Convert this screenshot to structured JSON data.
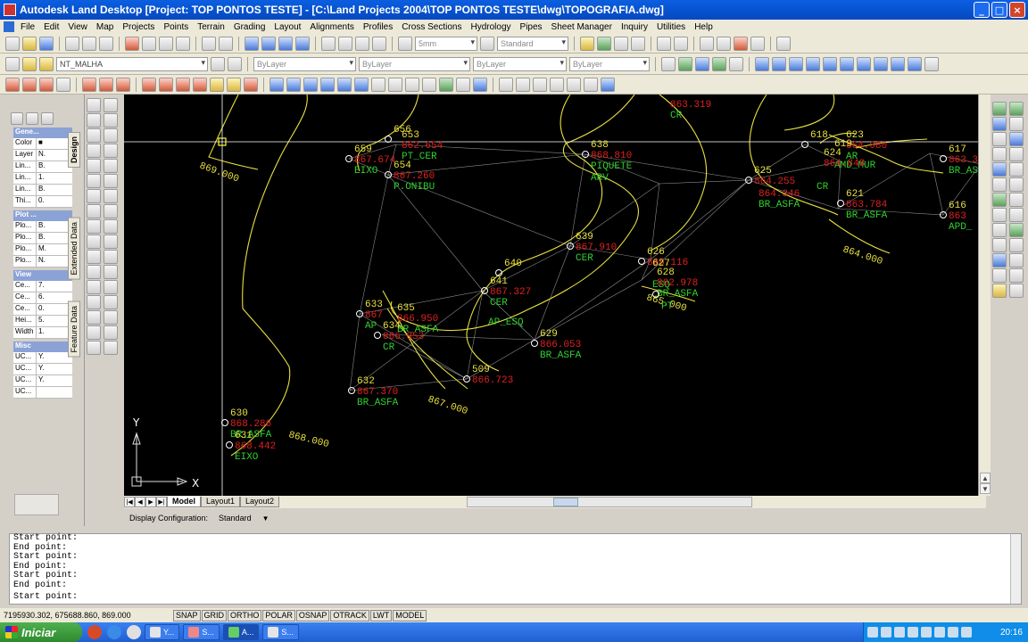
{
  "window": {
    "title": "Autodesk Land Desktop [Project: TOP PONTOS TESTE] - [C:\\Land Projects 2004\\TOP PONTOS TESTE\\dwg\\TOPOGRAFIA.dwg]"
  },
  "menu": [
    "File",
    "Edit",
    "View",
    "Map",
    "Projects",
    "Points",
    "Terrain",
    "Grading",
    "Layout",
    "Alignments",
    "Profiles",
    "Cross Sections",
    "Hydrology",
    "Pipes",
    "Sheet Manager",
    "Inquiry",
    "Utilities",
    "Help"
  ],
  "toolbar": {
    "text_height": "5mm",
    "text_style": "Standard",
    "layer": "NT_MALHA",
    "color": "ByLayer",
    "linetype": "ByLayer",
    "lineweight": "ByLayer",
    "plotstyle": "ByLayer"
  },
  "properties": {
    "tabs": [
      "Design",
      "Extended Data",
      "Feature Data"
    ],
    "sections": [
      {
        "title": "Gene...",
        "rows": [
          [
            "Color",
            "■"
          ],
          [
            "Layer",
            "N."
          ],
          [
            "Lin...",
            "B."
          ],
          [
            "Lin...",
            "1."
          ],
          [
            "Lin...",
            "B."
          ],
          [
            "Thi...",
            "0."
          ]
        ]
      },
      {
        "title": "Plot ...",
        "rows": [
          [
            "Plo...",
            "B."
          ],
          [
            "Plo...",
            "B."
          ],
          [
            "Plo...",
            "M."
          ],
          [
            "Plo...",
            "N."
          ]
        ]
      },
      {
        "title": "View",
        "rows": [
          [
            "Ce...",
            "7."
          ],
          [
            "Ce...",
            "6."
          ],
          [
            "Ce...",
            "0."
          ],
          [
            "Hei...",
            "5."
          ],
          [
            "Width",
            "1."
          ]
        ]
      },
      {
        "title": "Misc",
        "rows": [
          [
            "UC...",
            "Y."
          ],
          [
            "UC...",
            "Y."
          ],
          [
            "UC...",
            "Y."
          ],
          [
            "UC...",
            ""
          ]
        ]
      }
    ]
  },
  "drawing": {
    "contours": [
      {
        "label": "869.000"
      },
      {
        "label": "864.000"
      },
      {
        "label": "867.000"
      },
      {
        "label": "868.000"
      },
      {
        "label": "865.000"
      }
    ],
    "points": [
      {
        "num": "659",
        "elev": "867.674",
        "desc": "EIXO"
      },
      {
        "num": "656",
        "elev": "",
        "desc": ""
      },
      {
        "num": "653",
        "elev": "862.654",
        "desc": "PT_CER"
      },
      {
        "num": "654",
        "elev": "867.260",
        "desc": "P.ONIBU"
      },
      {
        "num": "638",
        "elev": "868.810",
        "desc": "PIQUETE"
      },
      {
        "num": "",
        "elev": "",
        "desc": "ARV"
      },
      {
        "num": "",
        "elev": "863.319",
        "desc": "CR"
      },
      {
        "num": "618",
        "elev": "",
        "desc": ""
      },
      {
        "num": "623",
        "elev": "864.080",
        "desc": "AR"
      },
      {
        "num": "619",
        "elev": "",
        "desc": "AMD_MUR"
      },
      {
        "num": "624",
        "elev": "864.848",
        "desc": ""
      },
      {
        "num": "",
        "elev": "",
        "desc": "CR"
      },
      {
        "num": "617",
        "elev": "863.397",
        "desc": "BR_ASF"
      },
      {
        "num": "625",
        "elev": "864.255",
        "desc": ""
      },
      {
        "num": "",
        "elev": "864.346",
        "desc": "BR_ASFA"
      },
      {
        "num": "621",
        "elev": "863.784",
        "desc": "BR_ASFA"
      },
      {
        "num": "616",
        "elev": "863",
        "desc": "APD_"
      },
      {
        "num": "639",
        "elev": "867.910",
        "desc": "CER"
      },
      {
        "num": "626",
        "elev": "865.116",
        "desc": ""
      },
      {
        "num": "627",
        "elev": "",
        "desc": "ESQ"
      },
      {
        "num": "628",
        "elev": "862.978",
        "desc": "BR_ASFA"
      },
      {
        "num": "",
        "elev": "",
        "desc": "PT"
      },
      {
        "num": "640",
        "elev": "",
        "desc": ""
      },
      {
        "num": "641",
        "elev": "867.327",
        "desc": "CER"
      },
      {
        "num": "",
        "elev": "",
        "desc": "AP_ESQ"
      },
      {
        "num": "633",
        "elev": "867",
        "desc": "AP"
      },
      {
        "num": "635",
        "elev": "866.950",
        "desc": "BR_ASFA"
      },
      {
        "num": "634",
        "elev": "866.953",
        "desc": "CR"
      },
      {
        "num": "629",
        "elev": "866.053",
        "desc": "BR_ASFA"
      },
      {
        "num": "509",
        "elev": "866.723",
        "desc": ""
      },
      {
        "num": "632",
        "elev": "867.370",
        "desc": "BR_ASFA"
      },
      {
        "num": "630",
        "elev": "868.286",
        "desc": "BR_ASFA"
      },
      {
        "num": "631",
        "elev": "868.442",
        "desc": "EIXO"
      }
    ],
    "ucs_x": "X",
    "ucs_y": "Y"
  },
  "layout_tabs": [
    "Model",
    "Layout1",
    "Layout2"
  ],
  "display_config": {
    "label": "Display Configuration:",
    "value": "Standard"
  },
  "command_lines": [
    "Start point:",
    "End point:",
    "Start point:",
    "End point:",
    "Start point:",
    "End point:"
  ],
  "command_prompt": "Start point:",
  "status": {
    "coords": "7195930.302, 675688.860, 869.000",
    "toggles": [
      "SNAP",
      "GRID",
      "ORTHO",
      "POLAR",
      "OSNAP",
      "OTRACK",
      "LWT",
      "MODEL"
    ]
  },
  "taskbar": {
    "start": "Iniciar",
    "tasks": [
      "Y...",
      "S...",
      "A...",
      "S..."
    ],
    "clock": "20:16"
  }
}
